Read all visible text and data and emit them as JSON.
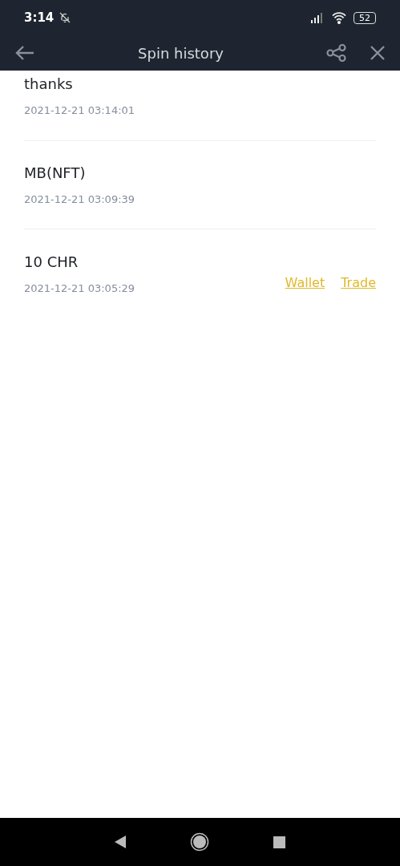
{
  "status_bar": {
    "time": "3:14",
    "battery": "52"
  },
  "header": {
    "title": "Spin history"
  },
  "entries": [
    {
      "title": "thanks",
      "time": "2021-12-21 03:14:01"
    },
    {
      "title": "MB(NFT)",
      "time": "2021-12-21 03:09:39"
    },
    {
      "title": "10 CHR",
      "time": "2021-12-21 03:05:29",
      "links": [
        "Wallet",
        "Trade"
      ]
    }
  ]
}
